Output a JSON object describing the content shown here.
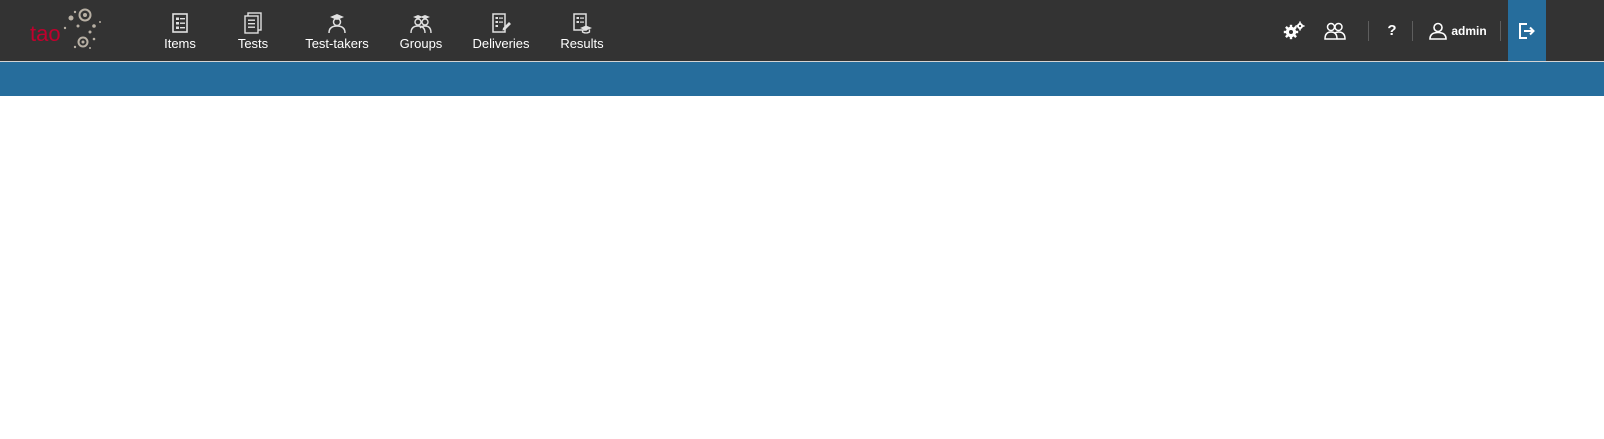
{
  "app": {
    "logo_text": "tao",
    "brand_color": "#c0002d",
    "accent_color": "#266d9c",
    "topbar_color": "#333333"
  },
  "nav": {
    "items": [
      {
        "label": "Items",
        "icon": "items-icon"
      },
      {
        "label": "Tests",
        "icon": "tests-icon"
      },
      {
        "label": "Test-takers",
        "icon": "test-takers-icon"
      },
      {
        "label": "Groups",
        "icon": "groups-icon"
      },
      {
        "label": "Deliveries",
        "icon": "deliveries-icon"
      },
      {
        "label": "Results",
        "icon": "results-icon"
      }
    ]
  },
  "actions": {
    "settings_icon": "gears-icon",
    "users_icon": "users-icon",
    "help_label": "?",
    "user_icon": "user-icon",
    "user_name": "admin",
    "logout_icon": "logout-icon"
  }
}
